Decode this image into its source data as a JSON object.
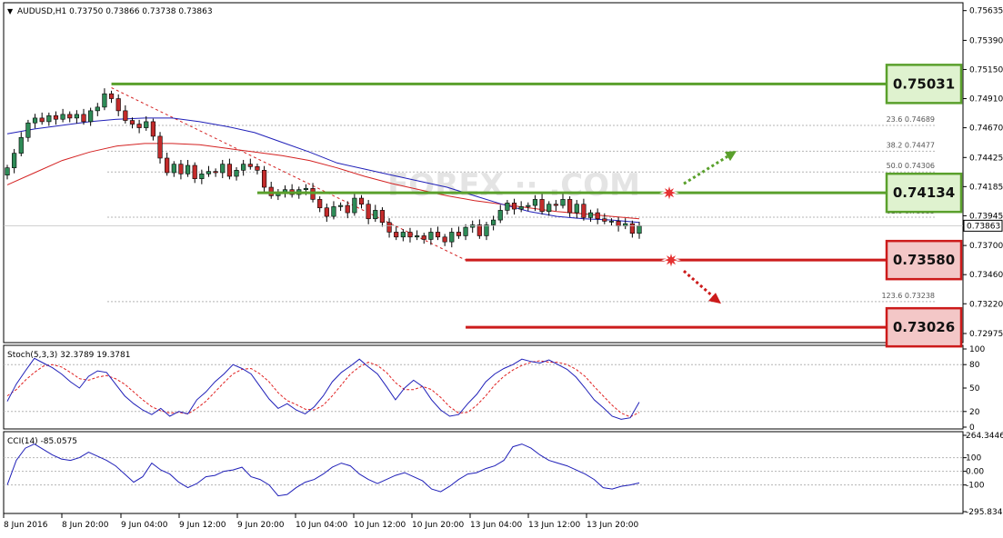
{
  "header": {
    "title": "AUDUSD,H1  0.73750 0.73866 0.73738 0.73863",
    "menu_glyph": "▼"
  },
  "colors": {
    "border": "#000000",
    "grid": "#b4b4b4",
    "bull": "#2e8b57",
    "bear": "#c42b2b",
    "ma_fast": "#1f1fb8",
    "ma_slow": "#d42222",
    "resistance": "#5aa02c",
    "support": "#cc1b1b",
    "resistance_box": "#dff2cf",
    "support_box": "#f3c7c7",
    "stoch_k": "#1f1fb8",
    "stoch_d": "#e02020",
    "cci": "#1f1fb8"
  },
  "watermark": "FOREX ·· .COM",
  "chart_data": [
    {
      "type": "candlestick",
      "symbol": "AUDUSD",
      "timeframe": "H1",
      "ohlc_header": {
        "open": 0.7375,
        "high": 0.73866,
        "low": 0.73738,
        "close": 0.73863
      },
      "ylim": [
        0.729,
        0.757
      ],
      "y_ticks": [
        "0.75635",
        "0.75390",
        "0.75150",
        "0.74910",
        "0.74670",
        "0.74425",
        "0.74185",
        "0.73945",
        "0.73700",
        "0.73460",
        "0.73220",
        "0.72975"
      ],
      "current_price": "0.73863",
      "x_tick_labels": [
        "8 Jun 2016",
        "8 Jun 20:00",
        "9 Jun 04:00",
        "9 Jun 12:00",
        "9 Jun 20:00",
        "10 Jun 04:00",
        "10 Jun 12:00",
        "10 Jun 20:00",
        "13 Jun 04:00",
        "13 Jun 12:00",
        "13 Jun 20:00"
      ],
      "closes": [
        0.7434,
        0.7446,
        0.7459,
        0.7471,
        0.7475,
        0.7472,
        0.7477,
        0.7474,
        0.7478,
        0.7475,
        0.7478,
        0.7472,
        0.7481,
        0.7484,
        0.7495,
        0.7491,
        0.7481,
        0.7473,
        0.747,
        0.7467,
        0.7472,
        0.746,
        0.7442,
        0.743,
        0.7437,
        0.7429,
        0.7436,
        0.7425,
        0.7429,
        0.7431,
        0.743,
        0.7437,
        0.7427,
        0.7432,
        0.7437,
        0.7435,
        0.7432,
        0.7418,
        0.7411,
        0.7414,
        0.7416,
        0.7412,
        0.7416,
        0.7417,
        0.7408,
        0.7401,
        0.7394,
        0.7402,
        0.7403,
        0.7397,
        0.7409,
        0.7404,
        0.7392,
        0.7399,
        0.7389,
        0.7381,
        0.7377,
        0.7381,
        0.7377,
        0.7378,
        0.7375,
        0.7381,
        0.7377,
        0.7373,
        0.7381,
        0.7378,
        0.7385,
        0.7387,
        0.7378,
        0.7387,
        0.7391,
        0.7399,
        0.7405,
        0.74,
        0.7402,
        0.7403,
        0.7408,
        0.7398,
        0.7404,
        0.7403,
        0.7408,
        0.7397,
        0.7404,
        0.7393,
        0.7397,
        0.7392,
        0.739,
        0.739,
        0.7386,
        0.7388,
        0.738,
        0.7386
      ],
      "moving_averages": {
        "fast": [
          0.7462,
          0.7466,
          0.7469,
          0.7472,
          0.7474,
          0.7475,
          0.7475,
          0.7472,
          0.7468,
          0.7463,
          0.7455,
          0.7447,
          0.7438,
          0.7433,
          0.7428,
          0.7423,
          0.7418,
          0.7411,
          0.7404,
          0.7398,
          0.7394,
          0.7392,
          0.7391,
          0.7389
        ],
        "slow": [
          0.742,
          0.743,
          0.744,
          0.7447,
          0.7452,
          0.7454,
          0.7454,
          0.7453,
          0.745,
          0.7447,
          0.7444,
          0.744,
          0.7434,
          0.7427,
          0.7421,
          0.7416,
          0.7411,
          0.7407,
          0.7404,
          0.7401,
          0.7398,
          0.7396,
          0.7394,
          0.7392
        ]
      },
      "trendline": {
        "from": 0.75,
        "to": 0.7358
      },
      "fibonacci": [
        {
          "label": "23.6",
          "value": "0.74689"
        },
        {
          "label": "38.2",
          "value": "0.74477"
        },
        {
          "label": "50.0",
          "value": "0.74306"
        },
        {
          "label": "61.8",
          "value": "0.73933"
        },
        {
          "label": "123.6",
          "value": "0.73238"
        }
      ],
      "levels": [
        {
          "kind": "resistance",
          "value": "0.75031",
          "price": 0.75031
        },
        {
          "kind": "resistance",
          "value": "0.74134",
          "price": 0.74134
        },
        {
          "kind": "support",
          "value": "0.73580",
          "price": 0.7358
        },
        {
          "kind": "support",
          "value": "0.73026",
          "price": 0.73026
        }
      ]
    },
    {
      "type": "line",
      "indicator": "Stochastic",
      "label": "Stoch(5,3,3) 32.3789 19.3781",
      "ylim": [
        0,
        100
      ],
      "y_ticks": [
        "100",
        "80",
        "50",
        "20",
        "0"
      ],
      "k": [
        33,
        55,
        72,
        88,
        82,
        76,
        68,
        58,
        50,
        65,
        72,
        70,
        55,
        40,
        30,
        22,
        16,
        24,
        14,
        20,
        17,
        35,
        45,
        58,
        68,
        80,
        75,
        68,
        52,
        36,
        24,
        30,
        22,
        17,
        26,
        40,
        58,
        70,
        78,
        87,
        77,
        68,
        52,
        35,
        50,
        60,
        52,
        35,
        22,
        14,
        16,
        30,
        42,
        58,
        68,
        75,
        80,
        87,
        84,
        82,
        86,
        80,
        74,
        64,
        50,
        35,
        25,
        14,
        10,
        12,
        32
      ],
      "d": [
        40,
        48,
        60,
        70,
        78,
        80,
        77,
        70,
        62,
        60,
        64,
        66,
        62,
        55,
        45,
        35,
        26,
        21,
        18,
        19,
        17,
        24,
        33,
        45,
        57,
        68,
        74,
        75,
        68,
        58,
        44,
        34,
        29,
        23,
        22,
        28,
        40,
        54,
        68,
        77,
        83,
        79,
        70,
        57,
        48,
        48,
        52,
        48,
        38,
        26,
        18,
        19,
        28,
        40,
        54,
        65,
        73,
        79,
        83,
        85,
        83,
        83,
        80,
        74,
        65,
        52,
        40,
        28,
        18,
        13,
        19
      ]
    },
    {
      "type": "line",
      "indicator": "CCI",
      "label": "CCI(14) -85.0575",
      "ylim": [
        -295.8341,
        264.3446
      ],
      "y_ticks": [
        "264.3446",
        "100",
        "0.00",
        "-100",
        "-295.8341"
      ],
      "values": [
        -100,
        80,
        170,
        200,
        160,
        120,
        90,
        80,
        100,
        140,
        110,
        80,
        40,
        -20,
        -80,
        -40,
        60,
        10,
        -20,
        -80,
        -120,
        -90,
        -40,
        -30,
        0,
        10,
        30,
        -40,
        -60,
        -100,
        -180,
        -170,
        -120,
        -80,
        -60,
        -20,
        30,
        60,
        40,
        -20,
        -60,
        -90,
        -60,
        -30,
        -10,
        -40,
        -70,
        -130,
        -150,
        -110,
        -60,
        -20,
        -10,
        20,
        40,
        80,
        180,
        200,
        170,
        120,
        80,
        60,
        40,
        10,
        -20,
        -60,
        -120,
        -130,
        -110,
        -100,
        -85
      ]
    }
  ]
}
